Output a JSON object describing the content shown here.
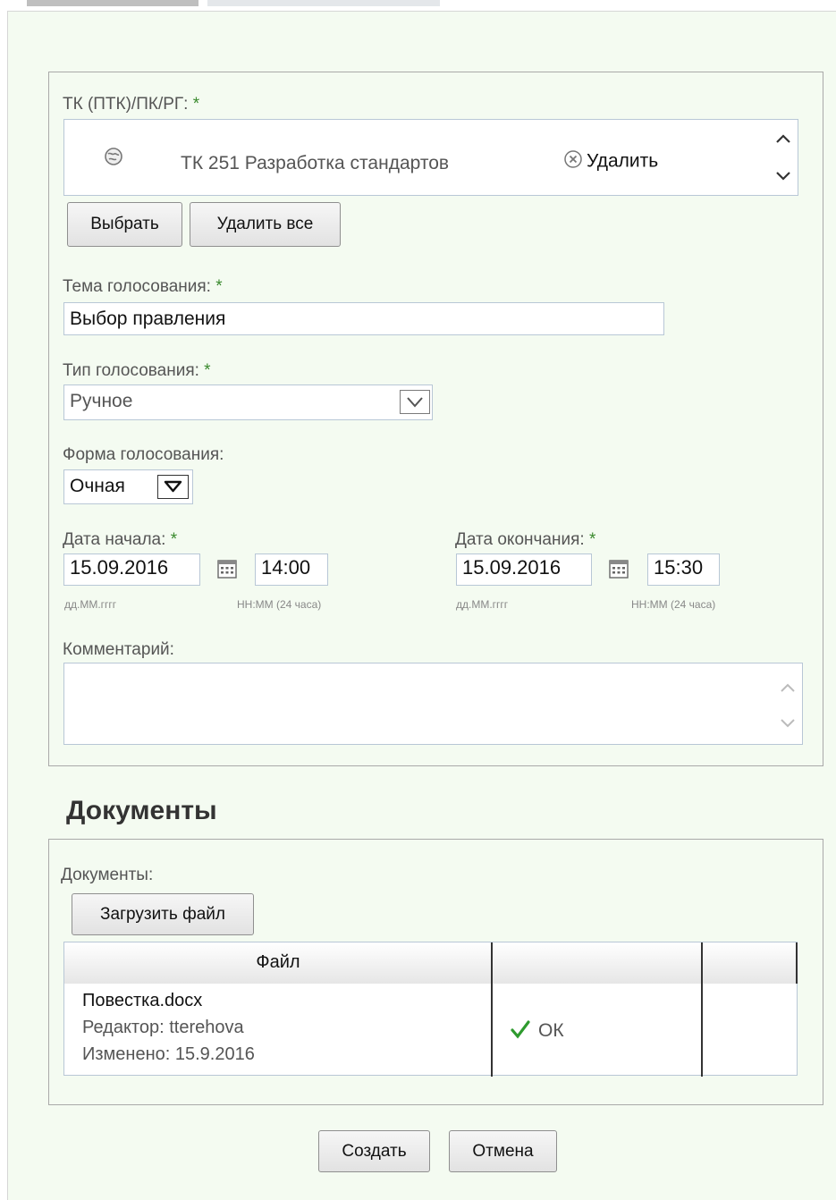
{
  "committee": {
    "label": "ТК (ПТК)/ПК/РГ:",
    "required_mark": "*",
    "selected_item": "ТК 251 Разработка стандартов",
    "remove_label": "Удалить",
    "select_button": "Выбрать",
    "remove_all_button": "Удалить все"
  },
  "topic": {
    "label": "Тема голосования:",
    "required_mark": "*",
    "value": "Выбор правления"
  },
  "vote_type": {
    "label": "Тип голосования:",
    "required_mark": "*",
    "value": "Ручное"
  },
  "vote_form": {
    "label": "Форма голосования:",
    "value": "Очная"
  },
  "start": {
    "label": "Дата начала:",
    "required_mark": "*",
    "date": "15.09.2016",
    "time": "14:00",
    "date_hint": "дд.ММ.гггг",
    "time_hint": "НН:ММ (24 часа)"
  },
  "end": {
    "label": "Дата окончания:",
    "required_mark": "*",
    "date": "15.09.2016",
    "time": "15:30",
    "date_hint": "дд.ММ.гггг",
    "time_hint": "НН:ММ (24 часа)"
  },
  "comment": {
    "label": "Комментарий:",
    "value": ""
  },
  "documents": {
    "heading": "Документы",
    "label": "Документы:",
    "upload_button": "Загрузить файл",
    "columns": [
      "Файл",
      "",
      ""
    ],
    "rows": [
      {
        "name": "Повестка.docx",
        "editor": "Редактор: tterehova",
        "modified": "Изменено: 15.9.2016",
        "status": "ОК"
      }
    ]
  },
  "actions": {
    "create_button": "Создать",
    "cancel_button": "Отмена"
  },
  "icons": {
    "globe": "globe-icon",
    "remove": "circle-x-icon",
    "calendar": "calendar-icon",
    "check": "check-icon",
    "scroll_up": "chevron-up-icon",
    "scroll_down": "chevron-down-icon",
    "dropdown": "dropdown-arrow-icon"
  },
  "colors": {
    "page_bg": "#f4fbf1",
    "required": "#3a8a2e",
    "check": "#2e9a2e"
  }
}
